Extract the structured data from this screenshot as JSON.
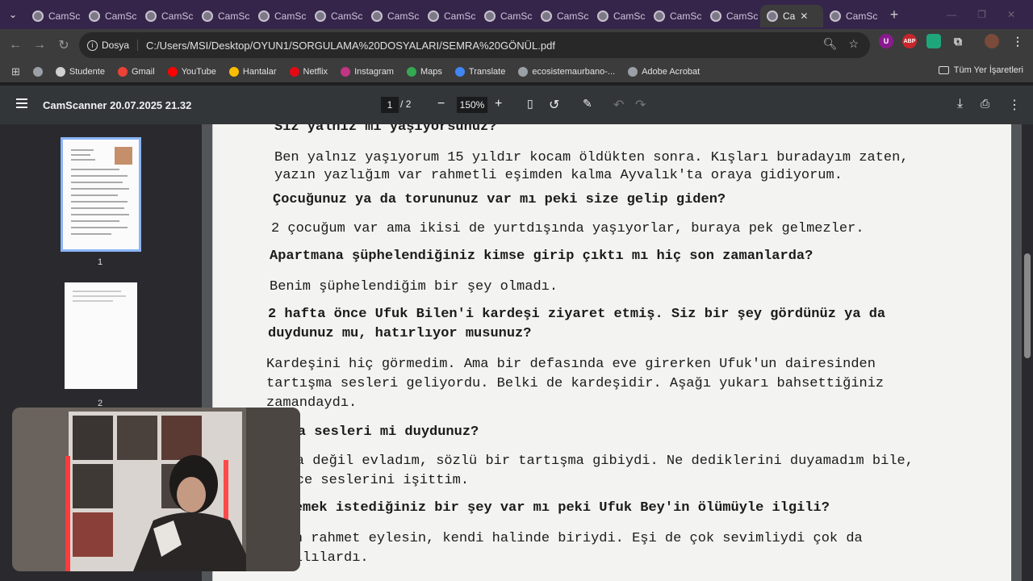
{
  "tabs": [
    {
      "label": "CamSc"
    },
    {
      "label": "CamSc"
    },
    {
      "label": "CamSc"
    },
    {
      "label": "CamSc"
    },
    {
      "label": "CamSc"
    },
    {
      "label": "CamSc"
    },
    {
      "label": "CamSc"
    },
    {
      "label": "CamSc"
    },
    {
      "label": "CamSc"
    },
    {
      "label": "CamSc"
    },
    {
      "label": "CamSc"
    },
    {
      "label": "CamSc"
    },
    {
      "label": "CamSc"
    },
    {
      "label": "Ca"
    },
    {
      "label": "CamSc"
    }
  ],
  "address": {
    "chip_label": "Dosya",
    "url": "C:/Users/MSI/Desktop/OYUN1/SORGULAMA%20DOSYALARI/SEMRA%20GÖNÜL.pdf"
  },
  "extensions": {
    "ublock": "U",
    "abp": "ABP"
  },
  "bookmarks": [
    {
      "label": "Studente",
      "color": "#d0d0d0"
    },
    {
      "label": "Gmail",
      "color": "#ea4335"
    },
    {
      "label": "YouTube",
      "color": "#ff0000"
    },
    {
      "label": "Hantalar",
      "color": "#fbbc04"
    },
    {
      "label": "Netflix",
      "color": "#e50914"
    },
    {
      "label": "Instagram",
      "color": "#c13584"
    },
    {
      "label": "Maps",
      "color": "#34a853"
    },
    {
      "label": "Translate",
      "color": "#4285f4"
    },
    {
      "label": "ecosistemaurbano-...",
      "color": "#9aa0a6"
    },
    {
      "label": "Adobe Acrobat",
      "color": "#9aa0a6"
    }
  ],
  "bookmarks_all": "Tüm Yer İşaretleri",
  "pdf": {
    "title": "CamScanner 20.07.2025 21.32",
    "current_page": "1",
    "page_sep": "/",
    "total_pages": "2",
    "zoom": "150%",
    "thumb_labels": [
      "1",
      "2"
    ]
  },
  "document": [
    {
      "type": "q",
      "text": "Siz yalnız mı yaşıyorsunuz?"
    },
    {
      "type": "a",
      "text": "Ben yalnız yaşıyorum 15 yıldır kocam öldükten sonra. Kışları buradayım zaten,"
    },
    {
      "type": "a",
      "text": "yazın yazlığım var rahmetli eşimden kalma Ayvalık'ta oraya gidiyorum."
    },
    {
      "type": "q",
      "text": "Çocuğunuz ya da torununuz var mı peki size gelip giden?"
    },
    {
      "type": "a",
      "text": "2 çocuğum var ama ikisi de yurtdışında yaşıyorlar, buraya pek gelmezler."
    },
    {
      "type": "q",
      "text": "Apartmana şüphelendiğiniz kimse girip çıktı mı hiç son zamanlarda?"
    },
    {
      "type": "a",
      "text": "Benim şüphelendiğim bir şey olmadı."
    },
    {
      "type": "q",
      "text": "2 hafta önce Ufuk Bilen'i kardeşi ziyaret etmiş. Siz bir şey gördünüz ya da"
    },
    {
      "type": "q",
      "text": "duydunuz mu, hatırlıyor musunuz?"
    },
    {
      "type": "a",
      "text": "Kardeşini hiç görmedim. Ama bir defasında eve girerken Ufuk'un dairesinden"
    },
    {
      "type": "a",
      "text": "tartışma sesleri geliyordu. Belki de kardeşidir. Aşağı yukarı bahsettiğiniz"
    },
    {
      "type": "a",
      "text": "zamandaydı."
    },
    {
      "type": "q",
      "text": "Kavga sesleri mi duydunuz?"
    },
    {
      "type": "a",
      "text": "Kavga değil evladım, sözlü bir tartışma gibiydi. Ne dediklerini duyamadım bile,"
    },
    {
      "type": "a",
      "text": "sadece seslerini işittim."
    },
    {
      "type": "q",
      "text": "Söylemek istediğiniz bir şey var mı peki Ufuk Bey'in ölümüyle ilgili?"
    },
    {
      "type": "a",
      "text": "Allah rahmet eylesin, kendi halinde biriydi. Eşi de çok sevimliydi çok da"
    },
    {
      "type": "a",
      "text": "saygılılardı."
    }
  ]
}
